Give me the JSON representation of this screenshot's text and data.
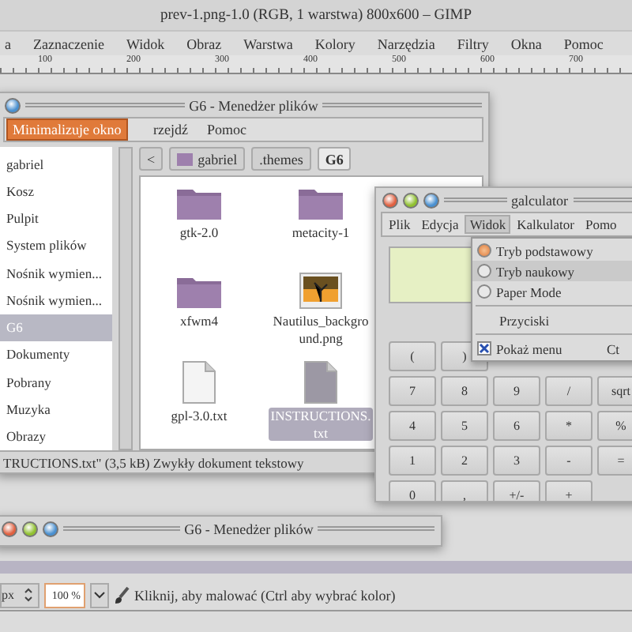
{
  "gimp": {
    "title": "prev-1.png-1.0 (RGB, 1 warstwa) 800x600 – GIMP",
    "menu": [
      "a",
      "Zaznaczenie",
      "Widok",
      "Obraz",
      "Warstwa",
      "Kolory",
      "Narzędzia",
      "Filtry",
      "Okna",
      "Pomoc"
    ],
    "ruler": [
      "100",
      "200",
      "300",
      "400",
      "500",
      "600",
      "700"
    ],
    "status": {
      "unit": "px",
      "zoom": "100 %",
      "message": "Kliknij, aby malować (Ctrl aby wybrać kolor)"
    }
  },
  "file_manager": {
    "title": "G6 - Menedżer plików",
    "tooltip": "Minimalizuje okno",
    "menu": [
      "rzejdź",
      "Pomoc"
    ],
    "sidebar": [
      {
        "label": "gabriel",
        "selected": false
      },
      {
        "label": "Kosz",
        "selected": false
      },
      {
        "label": "Pulpit",
        "selected": false
      },
      {
        "label": "System plików",
        "selected": false
      },
      {
        "label": "Nośnik wymien...",
        "selected": false
      },
      {
        "label": "Nośnik wymien...",
        "selected": false
      },
      {
        "label": "G6",
        "selected": true
      },
      {
        "label": "Dokumenty",
        "selected": false
      },
      {
        "label": "Pobrany",
        "selected": false
      },
      {
        "label": "Muzyka",
        "selected": false
      },
      {
        "label": "Obrazy",
        "selected": false
      }
    ],
    "back": "<",
    "path": [
      {
        "label": "gabriel",
        "selected": false
      },
      {
        "label": ".themes",
        "selected": false
      },
      {
        "label": "G6",
        "selected": true
      }
    ],
    "files": [
      {
        "name": "gtk-2.0",
        "kind": "folder",
        "selected": false
      },
      {
        "name": "metacity-1",
        "kind": "folder",
        "selected": false
      },
      {
        "name": "xfwm4",
        "kind": "folder",
        "selected": false
      },
      {
        "name": "Nautilus_background.png",
        "kind": "image",
        "selected": false
      },
      {
        "name": "gpl-3.0.txt",
        "kind": "text",
        "selected": false
      },
      {
        "name": "INSTRUCTIONS.txt",
        "kind": "text",
        "selected": true
      }
    ],
    "status": "TRUCTIONS.txt\" (3,5 kB) Zwykły dokument tekstowy"
  },
  "calculator": {
    "title": "galculator",
    "menu": [
      {
        "label": "Plik",
        "selected": false
      },
      {
        "label": "Edycja",
        "selected": false
      },
      {
        "label": "Widok",
        "selected": true
      },
      {
        "label": "Kalkulator",
        "selected": false
      },
      {
        "label": "Pomo",
        "selected": false
      }
    ],
    "keys": [
      [
        "(",
        ")"
      ],
      [
        "7",
        "8",
        "9",
        "/",
        "sqrt"
      ],
      [
        "4",
        "5",
        "6",
        "*",
        "%"
      ],
      [
        "1",
        "2",
        "3",
        "-",
        "="
      ],
      [
        "0",
        ",",
        "+/-",
        "+"
      ]
    ],
    "view_menu": [
      {
        "kind": "radio",
        "label": "Tryb podstawowy",
        "selected": true
      },
      {
        "kind": "radio",
        "label": "Tryb naukowy",
        "selected": false
      },
      {
        "kind": "radio",
        "label": "Paper Mode",
        "selected": false
      },
      {
        "kind": "separator"
      },
      {
        "kind": "plain",
        "label": "Przyciski"
      },
      {
        "kind": "separator"
      },
      {
        "kind": "check",
        "label": "Pokaż menu",
        "checked": true,
        "shortcut": "Ct"
      }
    ]
  },
  "second_window": {
    "title": "G6 - Menedżer plików"
  }
}
